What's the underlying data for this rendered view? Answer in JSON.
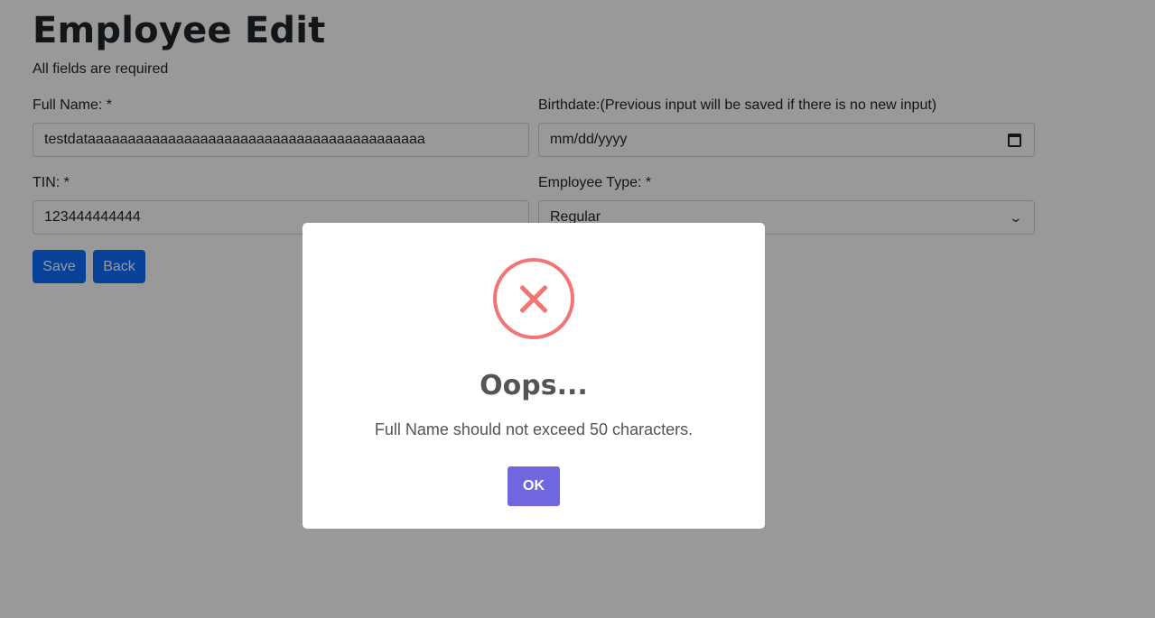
{
  "page": {
    "title": "Employee Edit",
    "subtitle": "All fields are required"
  },
  "form": {
    "full_name": {
      "label": "Full Name: *",
      "value": "testdataaaaaaaaaaaaaaaaaaaaaaaaaaaaaaaaaaaaaaaaaa"
    },
    "birthdate": {
      "label": "Birthdate:(Previous input will be saved if there is no new input)",
      "placeholder": "mm/dd/yyyy"
    },
    "tin": {
      "label": "TIN: *",
      "value": "123444444444"
    },
    "employee_type": {
      "label": "Employee Type: *",
      "selected": "Regular"
    }
  },
  "actions": {
    "save_label": "Save",
    "back_label": "Back"
  },
  "dialog": {
    "title": "Oops...",
    "message": "Full Name should not exceed 50 characters.",
    "ok_label": "OK"
  },
  "icons": {
    "birthdate": "calendar-icon",
    "employee_type": "chevron-down-icon",
    "dialog": "error-icon"
  },
  "colors": {
    "primary_button": "#0d6efd",
    "overlay": "rgba(0,0,0,0.4)",
    "error": "#f27474",
    "confirm_button": "#7066e0",
    "dialog_text": "#545454"
  }
}
